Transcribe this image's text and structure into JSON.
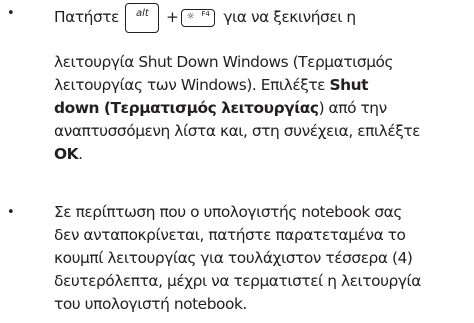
{
  "bullets": [
    {
      "marker": "•",
      "line1": {
        "before": "Πατήστε",
        "key_alt": "alt",
        "plus": "+",
        "key_f4": "F4",
        "after": "για να ξεκινήσει η"
      },
      "line2": "λειτουργία Shut Down Windows (Τερματισμός",
      "line3_a": "λειτουργίας των Windows). Επιλέξτε ",
      "line3_b": "Shut",
      "line4_b": "down (Τερματισμός λειτουργίας",
      "line4_a": ") από την",
      "line5": "αναπτυσσόμενη λίστα και, στη συνέχεια, επιλέξτε",
      "line6_b": "OK",
      "line6_a": "."
    },
    {
      "marker": "•",
      "lines": [
        "Σε περίπτωση που ο υπολογιστής notebook σας",
        "δεν ανταποκρίνεται, πατήστε παρατεταμένα το",
        "κουμπί λειτουργίας για τουλάχιστον τέσσερα (4)",
        "δευτερόλεπτα, μέχρι να τερματιστεί η λειτουργία",
        "του υπολογιστή notebook."
      ]
    }
  ]
}
